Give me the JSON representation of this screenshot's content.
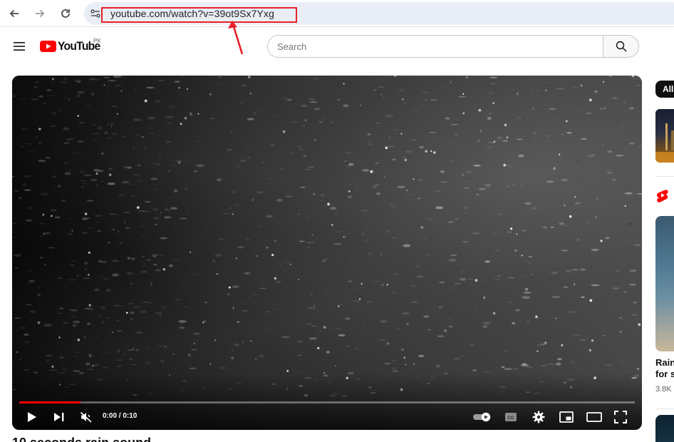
{
  "browser": {
    "url": "youtube.com/watch?v=39ot9Sx7Yxg",
    "back_icon": "arrow-left-icon",
    "forward_icon": "arrow-right-icon",
    "reload_icon": "reload-icon"
  },
  "header": {
    "logo_text": "YouTube",
    "country_code": "PK",
    "search_placeholder": "Search"
  },
  "player": {
    "time_display": "0:00 / 0:10",
    "progress": 0.1,
    "muted": true
  },
  "video": {
    "title": "10 seconds rain sound"
  },
  "sidebar": {
    "chip_all": "All",
    "short_title_line1": "Rain",
    "short_title_line2": "for s",
    "short_views": "3.8K"
  },
  "colors": {
    "accent_red": "#ff0000",
    "annotation_red": "#e8202a"
  }
}
